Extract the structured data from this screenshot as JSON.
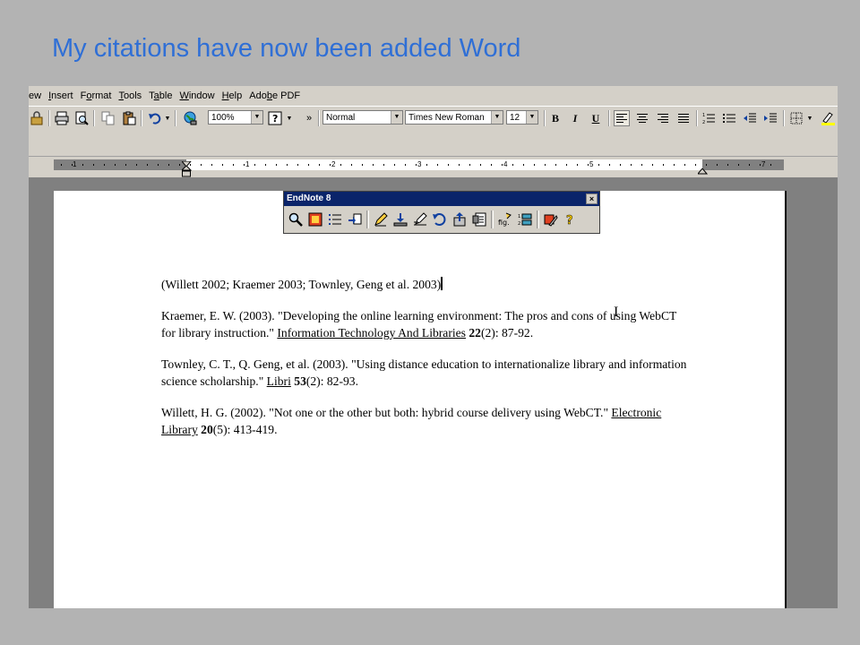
{
  "slide": {
    "title": "My citations have now been added Word"
  },
  "menubar": {
    "items": [
      {
        "pre": "",
        "u": "",
        "post": "ew"
      },
      {
        "pre": "",
        "u": "I",
        "post": "nsert"
      },
      {
        "pre": "F",
        "u": "o",
        "post": "rmat"
      },
      {
        "pre": "",
        "u": "T",
        "post": "ools"
      },
      {
        "pre": "T",
        "u": "a",
        "post": "ble"
      },
      {
        "pre": "",
        "u": "W",
        "post": "indow"
      },
      {
        "pre": "",
        "u": "H",
        "post": "elp"
      },
      {
        "pre": "Ado",
        "u": "b",
        "post": "e PDF"
      }
    ]
  },
  "toolbar": {
    "zoom": "100%",
    "style": "Normal",
    "font": "Times New Roman",
    "size": "12",
    "bold": "B",
    "italic": "I",
    "underline": "U",
    "overflow": "»"
  },
  "ruler": {
    "numbers": [
      "1",
      "1",
      "2",
      "3",
      "4",
      "5",
      "7"
    ]
  },
  "endnote": {
    "title": "EndNote 8",
    "close": "×"
  },
  "document": {
    "citation": "(Willett 2002; Kraemer 2003; Townley, Geng et al. 2003)",
    "refs": [
      {
        "before": "Kraemer, E. W. (2003). \"Developing the online learning environment: The pros and cons of using WebCT for library instruction.\" ",
        "journal": "Information Technology And Libraries",
        "volume": "22",
        "after": "(2): 87-92."
      },
      {
        "before": "Townley, C. T., Q. Geng, et al. (2003). \"Using distance education to internationalize library and information science scholarship.\" ",
        "journal": "Libri",
        "volume": "53",
        "after": "(2): 82-93."
      },
      {
        "before": "Willett, H. G. (2002). \"Not one or the other but both: hybrid course delivery using WebCT.\" ",
        "journal": "Electronic Library",
        "volume": "20",
        "after": "(5): 413-419."
      }
    ]
  },
  "cursor": {
    "glyph": "I"
  }
}
